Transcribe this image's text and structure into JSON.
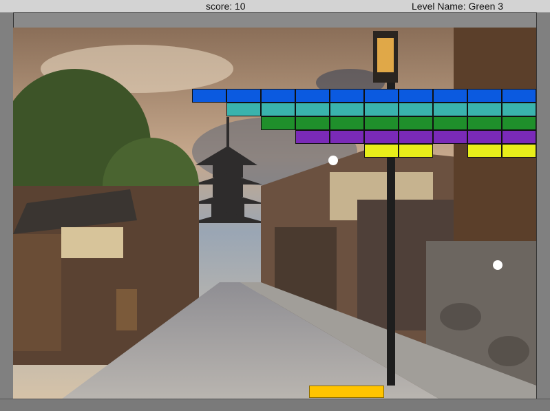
{
  "hud": {
    "score_text": "score: 10",
    "level_text": "Level Name: Green 3"
  },
  "colors": {
    "blue": "#0b5ae0",
    "teal": "#3ab3ad",
    "green": "#1f8f2b",
    "purple": "#7a2ab8",
    "yellow": "#e8ee1a",
    "paddle": "#ffc400"
  },
  "bricks": {
    "row1": [
      "blue",
      "blue",
      "blue",
      "blue",
      "blue",
      "blue",
      "blue",
      "blue",
      "blue",
      "blue"
    ],
    "row2": [
      "teal",
      "teal",
      "teal",
      "teal",
      "teal",
      "teal",
      "teal",
      "teal",
      "teal"
    ],
    "row3": [
      "green",
      "green",
      "green",
      "green",
      "green",
      "green",
      "green",
      "green"
    ],
    "row4": [
      "purple",
      "purple",
      "purple",
      "purple",
      "purple",
      "purple",
      "purple"
    ],
    "row5": [
      "yellow",
      "yellow",
      "yellow",
      "yellow"
    ]
  }
}
